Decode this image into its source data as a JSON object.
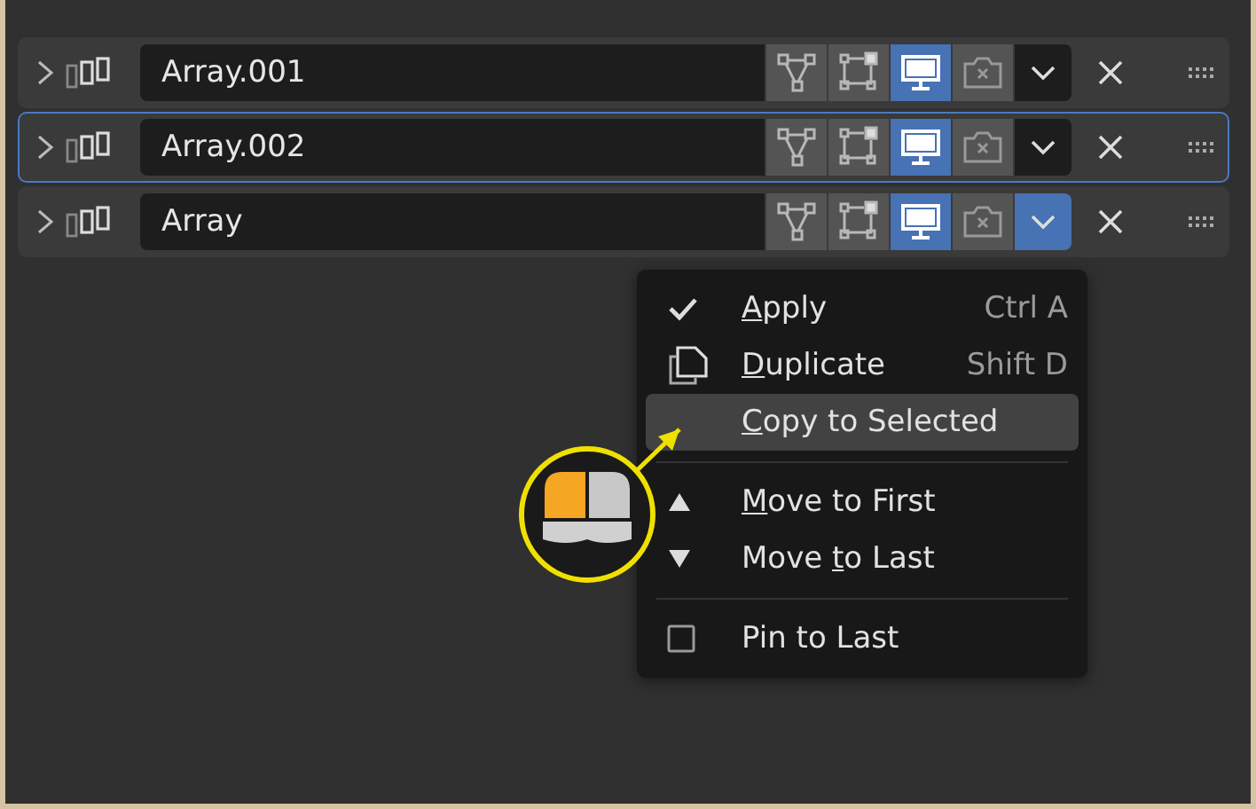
{
  "modifiers": [
    {
      "name": "Array.001",
      "selected": false,
      "edit_mode": false,
      "cage": false,
      "viewport": true,
      "render": false,
      "menu_open": false
    },
    {
      "name": "Array.002",
      "selected": true,
      "edit_mode": false,
      "cage": false,
      "viewport": true,
      "render": false,
      "menu_open": false
    },
    {
      "name": "Array",
      "selected": false,
      "edit_mode": false,
      "cage": false,
      "viewport": true,
      "render": false,
      "menu_open": true
    }
  ],
  "menu": {
    "items": [
      {
        "kind": "check",
        "key": "A",
        "post": "pply",
        "shortcut": "Ctrl A",
        "selected": false
      },
      {
        "kind": "copy",
        "key": "D",
        "post": "uplicate",
        "shortcut": "Shift D",
        "selected": false
      },
      {
        "kind": "plain",
        "key": "C",
        "post": "opy to Selected",
        "selected": true
      },
      {
        "kind": "separator"
      },
      {
        "kind": "up",
        "key": "M",
        "post": "ove to First",
        "selected": false
      },
      {
        "kind": "down",
        "pre": "Move ",
        "key": "t",
        "post": "o Last",
        "selected": false
      },
      {
        "kind": "separator"
      },
      {
        "kind": "checkbox",
        "pre": "Pin to Last",
        "checked": false,
        "selected": false
      }
    ]
  }
}
